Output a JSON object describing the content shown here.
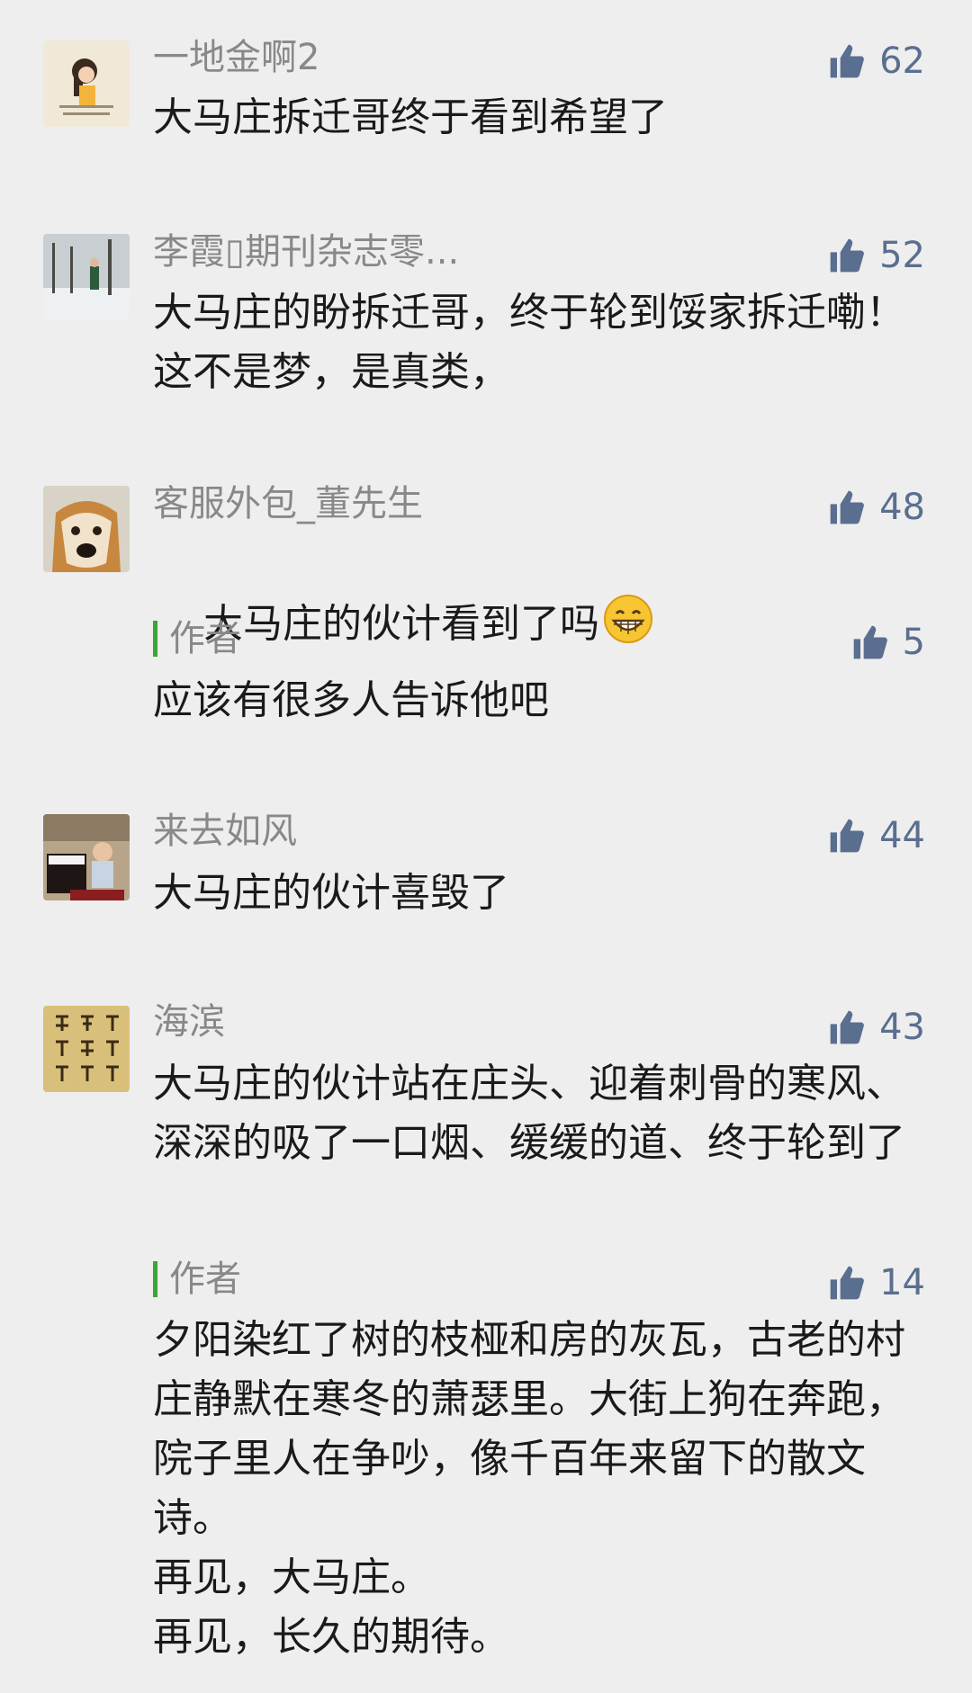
{
  "comments": [
    {
      "name": "一地金啊2",
      "likes": "62",
      "text": "大马庄拆迁哥终于看到希望了",
      "avatar": "avatar-cartoon-girl"
    },
    {
      "name": "李霞▯期刊杂志零...",
      "likes": "52",
      "text": "大马庄的盼拆迁哥，终于轮到馁家拆迁嘞！这不是梦，是真类，",
      "avatar": "avatar-snow-trees"
    },
    {
      "name": "客服外包_董先生",
      "likes": "48",
      "text": "大马庄的伙计看到了吗",
      "avatar": "avatar-dog",
      "emoji": "grinning-face-emoji",
      "reply": {
        "name": "作者",
        "likes": "5",
        "text": "应该有很多人告诉他吧"
      }
    },
    {
      "name": "来去如风",
      "likes": "44",
      "text": "大马庄的伙计喜毁了",
      "avatar": "avatar-child-piano"
    },
    {
      "name": "海滨",
      "likes": "43",
      "text": "大马庄的伙计站在庄头、迎着刺骨的寒风、深深的吸了一口烟、缓缓的道、终于轮到了",
      "avatar": "avatar-calligraphy",
      "reply": {
        "name": "作者",
        "likes": "14",
        "text": "夕阳染红了树的枝桠和房的灰瓦，古老的村庄静默在寒冬的萧瑟里。大街上狗在奔跑，院子里人在争吵，像千百年来留下的散文诗。\n再见，大马庄。\n再见，长久的期待。"
      }
    }
  ],
  "colors": {
    "background": "#eeeeee",
    "name": "#888888",
    "like": "#5a6e8f",
    "reply_bar": "#3aa635",
    "text": "#1a1a1a"
  },
  "icons": {
    "like": "thumbs-up-icon"
  }
}
